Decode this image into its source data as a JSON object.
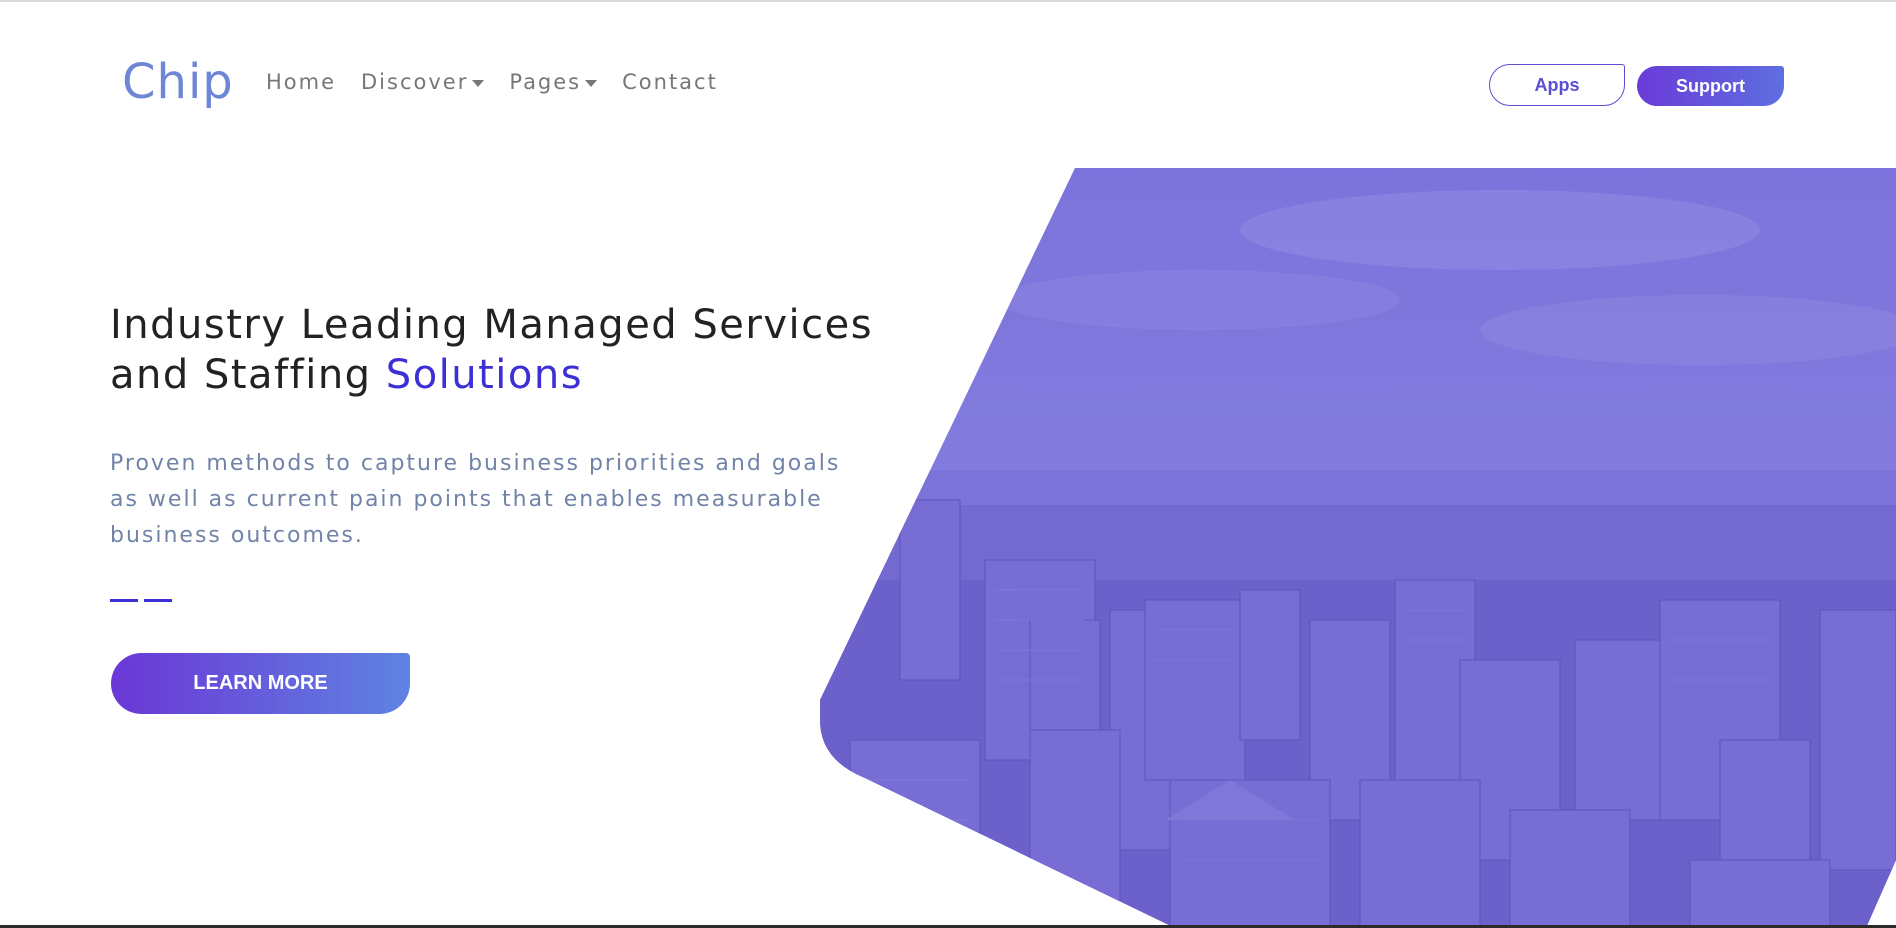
{
  "brand": {
    "name": "Chip"
  },
  "nav": {
    "items": [
      {
        "label": "Home",
        "dropdown": false
      },
      {
        "label": "Discover",
        "dropdown": true
      },
      {
        "label": "Pages",
        "dropdown": true
      },
      {
        "label": "Contact",
        "dropdown": false
      }
    ]
  },
  "header_actions": {
    "apps_label": "Apps",
    "support_label": "Support"
  },
  "hero": {
    "title_part1": "Industry Leading Managed Services",
    "title_part2": "and Staffing ",
    "title_accent": "Solutions",
    "subtitle": "Proven methods to capture business priorities and goals as well as current pain points that enables measurable business outcomes.",
    "cta_label": "LEARN MORE"
  },
  "colors": {
    "accent": "#3d2fd6",
    "brand": "#6e86d6",
    "gradient_start": "#6a37d6",
    "gradient_end": "#5f83e2",
    "image_overlay": "#7b70dc"
  }
}
